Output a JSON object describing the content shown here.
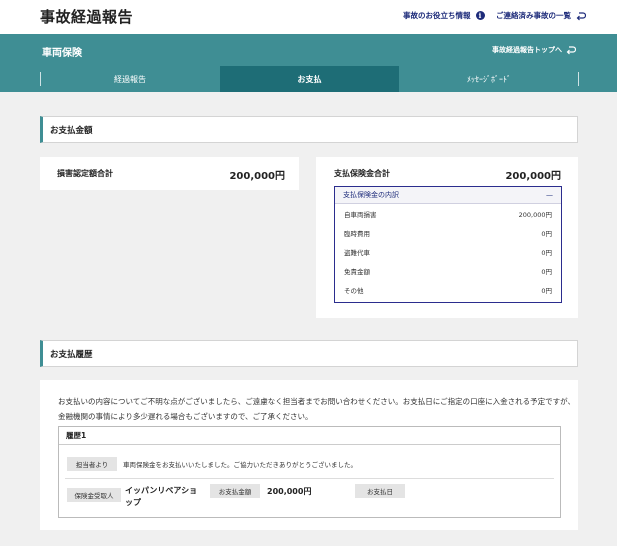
{
  "header": {
    "title": "事故経過報告",
    "link_info": "事故のお役立ち情報",
    "link_list": "ご連絡済み事故の一覧"
  },
  "band": {
    "section_title": "車両保険",
    "back_link": "事故経過報告トップへ"
  },
  "tabs": [
    {
      "label": "経過報告",
      "active": false
    },
    {
      "label": "お支払",
      "active": true
    },
    {
      "label": "ﾒｯｾｰｼﾞﾎﾞｰﾄﾞ",
      "active": false
    }
  ],
  "payment_amount": {
    "section_title": "お支払金額",
    "damage_label": "損害認定額合計",
    "damage_value": "200,000円",
    "insurance_label": "支払保険金合計",
    "insurance_value": "200,000円",
    "breakdown": {
      "title": "支払保険金の内訳",
      "toggle": "—",
      "rows": [
        {
          "label": "自車両損害",
          "value": "200,000円"
        },
        {
          "label": "臨時費用",
          "value": "0円"
        },
        {
          "label": "盗難代車",
          "value": "0円"
        },
        {
          "label": "免責金額",
          "value": "0円"
        },
        {
          "label": "その他",
          "value": "0円"
        }
      ]
    }
  },
  "history": {
    "section_title": "お支払履歴",
    "notice": "お支払いの内容についてご不明な点がございましたら、ご遠慮なく担当者までお問い合わせください。お支払日にご指定の口座に入金される予定ですが、金融機関の事情により多少遅れる場合もございますので、ご了承ください。",
    "entry_title": "履歴1",
    "from_label": "担当者より",
    "from_message": "車両保険金をお支払いいたしました。ご協力いただきありがとうございました。",
    "recipient_label": "保険金受取人",
    "recipient_value": "イッパンリペアショップ",
    "amount_label": "お支払金額",
    "amount_value": "200,000円",
    "date_label": "お支払日"
  },
  "colors": {
    "teal": "#3f8e94",
    "teal_dark": "#1e6d76",
    "navy": "#1d2b7a"
  }
}
